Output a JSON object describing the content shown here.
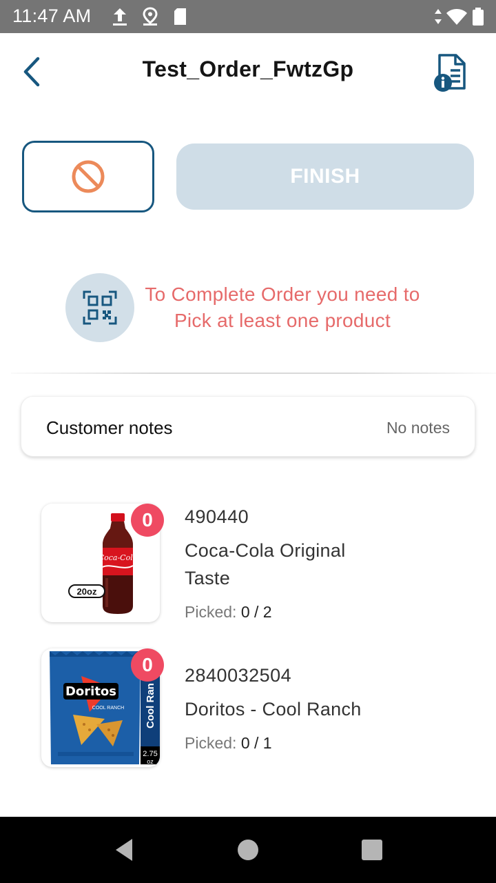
{
  "status_bar": {
    "time": "11:47 AM",
    "icons": [
      "upload-icon",
      "location-icon",
      "sd-card-icon",
      "data-arrows-icon",
      "wifi-icon",
      "battery-icon"
    ]
  },
  "header": {
    "title": "Test_Order_FwtzGp",
    "back_icon": "chevron-left-icon",
    "info_icon": "document-info-icon"
  },
  "actions": {
    "cancel_icon": "prohibited-icon",
    "finish_label": "FINISH"
  },
  "scan_prompt": {
    "icon": "qr-code-icon",
    "message": "To Complete Order you need to Pick at least one product"
  },
  "customer_notes": {
    "label": "Customer notes",
    "value": "No notes"
  },
  "products": [
    {
      "code": "490440",
      "name": "Coca-Cola Original Taste",
      "picked_label": "Picked:",
      "picked_value": "0 / 2",
      "badge": "0",
      "image_labels": [
        "Coca-Cola",
        "20oz"
      ]
    },
    {
      "code": "2840032504",
      "name": "Doritos - Cool Ranch",
      "picked_label": "Picked:",
      "picked_value": "0 / 1",
      "badge": "0",
      "image_labels": [
        "Doritos",
        "COOL RANCH",
        "Cool Ran",
        "2.75",
        "oz"
      ]
    }
  ],
  "colors": {
    "primary": "#17577f",
    "accent_orange": "#ec8a5a",
    "error_text": "#e66a6a",
    "badge": "#ef4a62",
    "finish_disabled": "#cfdde7"
  }
}
